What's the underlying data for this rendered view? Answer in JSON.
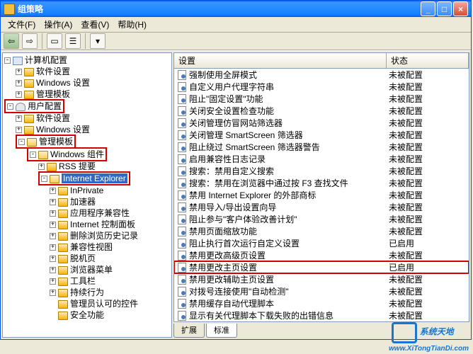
{
  "title": "组策略",
  "menus": [
    "文件(F)",
    "操作(A)",
    "查看(V)",
    "帮助(H)"
  ],
  "tree": {
    "root": "计算机配置",
    "c1": "软件设置",
    "c2": "Windows 设置",
    "c3": "管理模板",
    "u": "用户配置",
    "u1": "软件设置",
    "u2": "Windows 设置",
    "u3": "管理模板",
    "w": "Windows 组件",
    "w1": "RSS 提要",
    "ie": "Internet Explorer",
    "ie_items": [
      "InPrivate",
      "加速器",
      "应用程序兼容性",
      "Internet 控制面板",
      "删除浏览历史记录",
      "兼容性视图",
      "脱机页",
      "浏览器菜单",
      "工具栏",
      "持续行为",
      "管理员认可的控件",
      "安全功能"
    ]
  },
  "list_headers": {
    "col1": "设置",
    "col2": "状态"
  },
  "list": [
    {
      "n": "强制使用全屏模式",
      "s": "未被配置"
    },
    {
      "n": "自定义用户代理字符串",
      "s": "未被配置"
    },
    {
      "n": "阻止\"固定设置\"功能",
      "s": "未被配置"
    },
    {
      "n": "关闭安全设置检查功能",
      "s": "未被配置"
    },
    {
      "n": "关闭管理仿冒网站筛选器",
      "s": "未被配置"
    },
    {
      "n": "关闭管理 SmartScreen 筛选器",
      "s": "未被配置"
    },
    {
      "n": "阻止绕过 SmartScreen 筛选器警告",
      "s": "未被配置"
    },
    {
      "n": "启用兼容性日志记录",
      "s": "未被配置"
    },
    {
      "n": "搜索：禁用自定义搜索",
      "s": "未被配置"
    },
    {
      "n": "搜索：禁用在浏览器中通过按 F3 查找文件",
      "s": "未被配置"
    },
    {
      "n": "禁用 Internet Explorer 的外部商标",
      "s": "未被配置"
    },
    {
      "n": "禁用导入/导出设置向导",
      "s": "未被配置"
    },
    {
      "n": "阻止参与\"客户体验改善计划\"",
      "s": "未被配置"
    },
    {
      "n": "禁用页面缩放功能",
      "s": "未被配置"
    },
    {
      "n": "阻止执行首次运行自定义设置",
      "s": "已启用"
    },
    {
      "n": "禁用更改高级页设置",
      "s": "未被配置"
    },
    {
      "n": "禁用更改主页设置",
      "s": "已启用",
      "hl": true
    },
    {
      "n": "禁用更改辅助主页设置",
      "s": "未被配置"
    },
    {
      "n": "对拨号连接使用\"自动检测\"",
      "s": "未被配置"
    },
    {
      "n": "禁用缓存自动代理脚本",
      "s": "未被配置"
    },
    {
      "n": "显示有关代理脚本下载失败的出错信息",
      "s": "未被配置"
    }
  ],
  "tabs": {
    "ext": "扩展",
    "std": "标准"
  },
  "watermark": {
    "text": "系统天地",
    "url": "www.XiTongTianDi.com"
  }
}
